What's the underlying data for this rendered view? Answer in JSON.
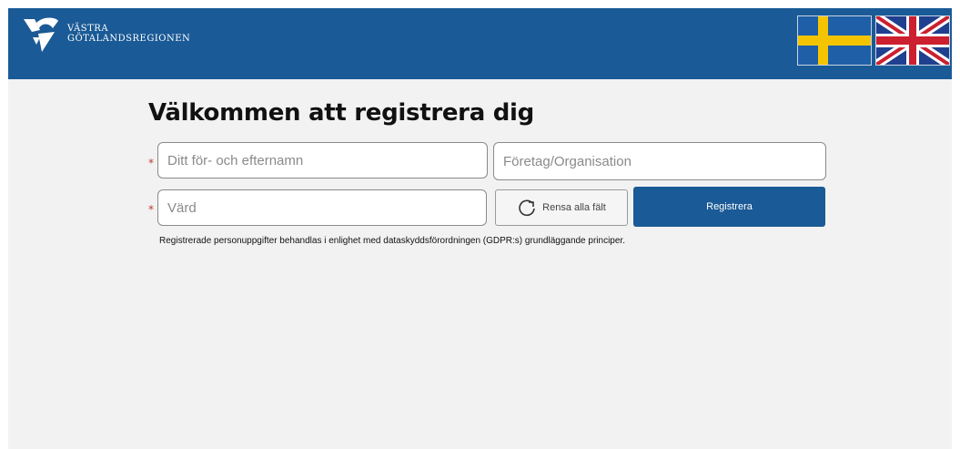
{
  "header": {
    "logo_line1": "VÄSTRA",
    "logo_line2": "GÖTALANDSREGIONEN",
    "colors": {
      "background": "#1a5a96"
    },
    "languages": [
      {
        "icon": "swedish-flag-icon"
      },
      {
        "icon": "uk-flag-icon"
      }
    ]
  },
  "form": {
    "title": "Välkommen att registrera dig",
    "name_placeholder": "Ditt för- och efternamn",
    "company_placeholder": "Företag/Organisation",
    "host_placeholder": "Värd",
    "required_marker": "*",
    "clear_label": "Rensa alla fält",
    "clear_icon": "refresh-icon",
    "register_label": "Registrera",
    "gdpr_notice": "Registrerade personuppgifter behandlas i enlighet med dataskyddsförordningen (GDPR:s) grundläggande principer."
  }
}
